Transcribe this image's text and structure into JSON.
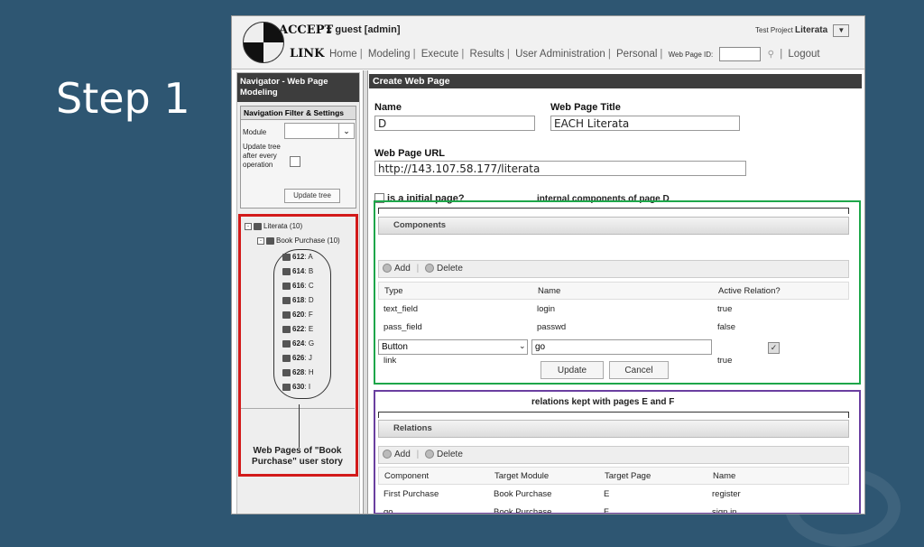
{
  "slide": {
    "title": "Step 1"
  },
  "header": {
    "brand_top": "ACCEPT",
    "brand_bottom": "LINK",
    "user": ":: guest [admin]",
    "nav": [
      "Home",
      "Modeling",
      "Execute",
      "Results",
      "User Administration",
      "Personal"
    ],
    "web_page_id_label": "Web Page ID:",
    "logout": "Logout",
    "project_label": "Test Project",
    "project_value": "Literata"
  },
  "navigator": {
    "title": "Navigator - Web Page Modeling",
    "filter_title": "Navigation Filter & Settings",
    "module_label": "Module",
    "update_label": "Update tree after every operation",
    "update_button": "Update tree",
    "tree_root": "Literata (10)",
    "tree_group": "Book Purchase (10)",
    "pages": [
      {
        "id": "612",
        "name": "A"
      },
      {
        "id": "614",
        "name": "B"
      },
      {
        "id": "616",
        "name": "C"
      },
      {
        "id": "618",
        "name": "D"
      },
      {
        "id": "620",
        "name": "F"
      },
      {
        "id": "622",
        "name": "E"
      },
      {
        "id": "624",
        "name": "G"
      },
      {
        "id": "626",
        "name": "J"
      },
      {
        "id": "628",
        "name": "H"
      },
      {
        "id": "630",
        "name": "I"
      }
    ],
    "caption": "Web Pages of \"Book Purchase\" user story"
  },
  "form": {
    "title": "Create Web Page",
    "name_label": "Name",
    "name_value": "D",
    "page_title_label": "Web Page Title",
    "page_title_value": "EACH Literata",
    "url_label": "Web Page URL",
    "url_value": "http://143.107.58.177/literata",
    "initial_label": "is a initial page?",
    "components_annotation": "internal components of page D",
    "relations_annotation": "relations kept with pages E and F"
  },
  "components": {
    "section_title": "Components",
    "add": "Add",
    "delete": "Delete",
    "columns": [
      "Type",
      "Name",
      "Active Relation?"
    ],
    "rows": [
      [
        "text_field",
        "login",
        "true"
      ],
      [
        "pass_field",
        "passwd",
        "false"
      ]
    ],
    "edit_type": "Button",
    "edit_name": "go",
    "hidden_row": [
      "link",
      "true"
    ],
    "update_button": "Update",
    "cancel_button": "Cancel"
  },
  "relations": {
    "section_title": "Relations",
    "add": "Add",
    "delete": "Delete",
    "columns": [
      "Component",
      "Target Module",
      "Target Page",
      "Name"
    ],
    "rows": [
      [
        "First Purchase",
        "Book Purchase",
        "E",
        "register"
      ],
      [
        "go",
        "Book Purchase",
        "F",
        "sign in"
      ]
    ]
  },
  "colors": {
    "background": "#2e5672",
    "red": "#d21a1a",
    "green": "#1ea64a",
    "purple": "#6a3fa0"
  }
}
